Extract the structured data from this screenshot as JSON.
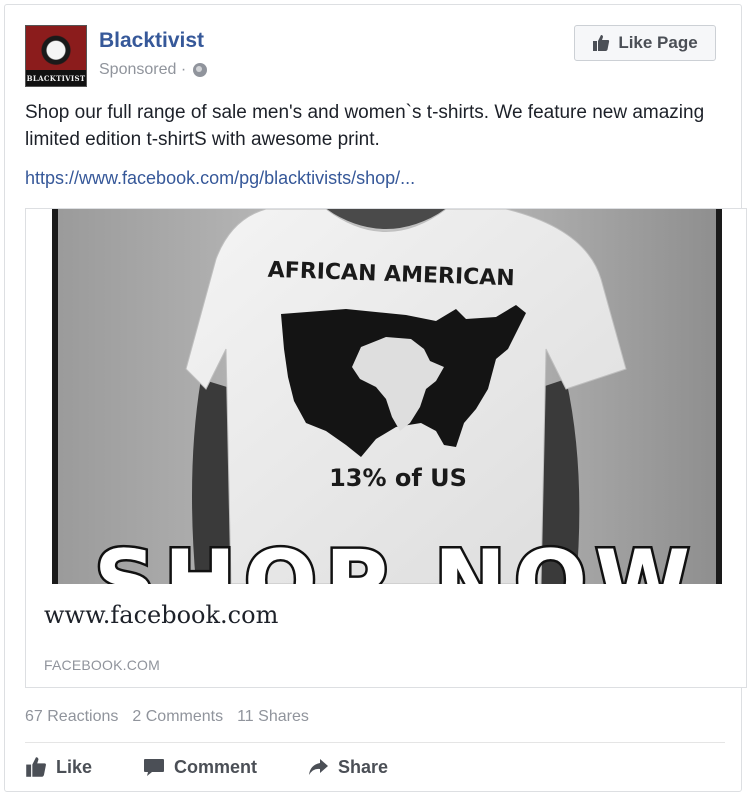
{
  "post": {
    "page_name": "Blacktivist",
    "sponsored_label": "Sponsored ·",
    "avatar_text": "BLACKTIVIST",
    "like_page_label": "Like Page",
    "body_text": "Shop our full range of sale men's and women`s t-shirts. We feature new amazing limited edition t-shirtS with awesome print.",
    "link_url": "https://www.facebook.com/pg/blacktivists/shop/..."
  },
  "attachment": {
    "image": {
      "shirt_heading": "AFRICAN AMERICAN",
      "shirt_caption": "13% of US",
      "overlay_text": "SHOP NOW"
    },
    "link_title": "www.facebook.com",
    "link_domain": "FACEBOOK.COM"
  },
  "stats": {
    "reactions": "67 Reactions",
    "comments": "2 Comments",
    "shares": "11 Shares"
  },
  "actions": {
    "like": "Like",
    "comment": "Comment",
    "share": "Share"
  },
  "colors": {
    "link_blue": "#365899",
    "muted_gray": "#90949c",
    "action_gray": "#4b4f56"
  },
  "icons": [
    "globe-icon",
    "thumbs-up-icon",
    "comment-icon",
    "share-icon"
  ]
}
